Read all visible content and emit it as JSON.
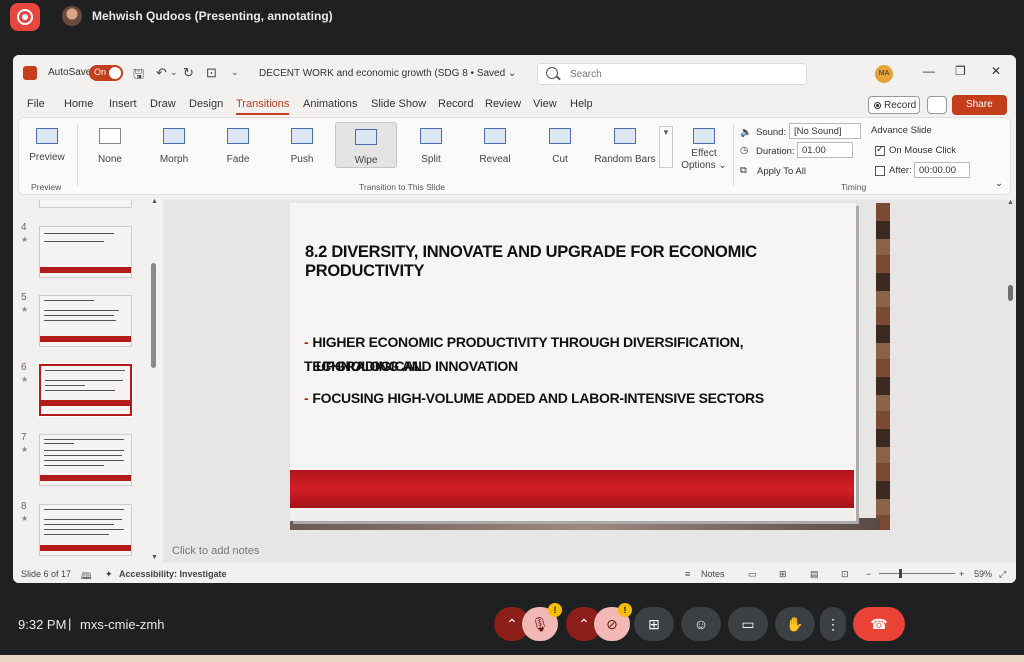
{
  "meet": {
    "presenter_label": "Mehwish Qudoos (Presenting, annotating)",
    "time": "9:32 PM",
    "separator": "|",
    "meeting_code": "mxs-cmie-zmh",
    "warn_badge": "!"
  },
  "ppt": {
    "autosave_label": "AutoSave",
    "autosave_state": "On",
    "doc_title": "DECENT WORK and economic growth  (SDG 8 • Saved ⌄",
    "search_placeholder": "Search",
    "user_initials": "MA",
    "menu": [
      "File",
      "Home",
      "Insert",
      "Draw",
      "Design",
      "Transitions",
      "Animations",
      "Slide Show",
      "Record",
      "Review",
      "View",
      "Help"
    ],
    "active_menu": "Transitions",
    "record_label": "Record",
    "share_label": "Share",
    "ribbon": {
      "preview_label": "Preview",
      "preview_group": "Preview",
      "transitions": [
        "None",
        "Morph",
        "Fade",
        "Push",
        "Wipe",
        "Split",
        "Reveal",
        "Cut",
        "Random Bars"
      ],
      "selected_transition": "Wipe",
      "effect_options_line1": "Effect",
      "effect_options_line2": "Options ⌄",
      "transition_group": "Transition to This Slide",
      "sound_label": "Sound:",
      "sound_value": "[No Sound]",
      "duration_label": "Duration:",
      "duration_value": "01.00",
      "apply_all": "Apply To All",
      "advance_label": "Advance Slide",
      "on_click_label": "On Mouse Click",
      "after_label": "After:",
      "after_value": "00:00.00",
      "timing_group": "Timing"
    },
    "thumbnails": [
      {
        "num": "4",
        "selected": false
      },
      {
        "num": "5",
        "selected": false
      },
      {
        "num": "6",
        "selected": true
      },
      {
        "num": "7",
        "selected": false
      },
      {
        "num": "8",
        "selected": false
      }
    ],
    "slide": {
      "title": "8.2 DIVERSITY, INNOVATE AND UPGRADE FOR ECONOMIC PRODUCTIVITY",
      "bullet1_line1": "HIGHER ECONOMIC PRODUCTIVITY THROUGH DIVERSIFICATION, TECHNOLOGICAL",
      "bullet1_line2": "UPGRADING AND INNOVATION",
      "bullet2": "FOCUSING HIGH-VOLUME ADDED AND LABOR-INTENSIVE SECTORS",
      "bullet_mark": "-"
    },
    "notes_placeholder": "Click to add notes",
    "status": {
      "slide_count": "Slide 6 of 17",
      "accessibility": "Accessibility: Investigate",
      "notes": "Notes",
      "zoom": "59%"
    }
  }
}
